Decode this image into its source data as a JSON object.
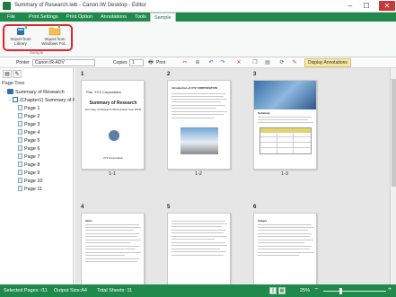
{
  "window": {
    "title": "Summary of Research.iwb - Canon iW Desktop - Editor",
    "minimize": "–",
    "maximize": "☐",
    "close": "✕"
  },
  "ribbon_tabs": [
    "File",
    "Print Settings",
    "Print Option",
    "Annotations",
    "Tools",
    "Sample"
  ],
  "ribbon": {
    "import_library": "Import from Library",
    "import_windows": "Import from Windows Fol...",
    "group_label": "Sample"
  },
  "toolbar": {
    "printer_label": "Printer",
    "printer_value": "Canon iR-ADV",
    "copies_label": "Copies",
    "copies_value": "1",
    "print_label": "Print",
    "display_annotations": "Display Annotations"
  },
  "left_pane": {
    "header": "Page Tree",
    "root": "Summary of Research",
    "chapter": "(Chapter1) Summary of R",
    "pages": [
      "Page 1",
      "Page 2",
      "Page 3",
      "Page 4",
      "Page 5",
      "Page 6",
      "Page 7",
      "Page 8",
      "Page 9",
      "Page 10",
      "Page 11"
    ]
  },
  "thumbnails": {
    "row1": [
      {
        "num": "1",
        "label": "1-1",
        "company": "Pas. XYZ Corporation",
        "heading": "Summary of Research",
        "sub": "Summary of Research Work (Fiscal Year 2015)",
        "footer": "XYZ Corporation"
      },
      {
        "num": "2",
        "label": "1-2",
        "heading": "Introduction of XYZ CORPORATION"
      },
      {
        "num": "3",
        "label": "1-3",
        "heading": "Summary"
      }
    ],
    "row2": [
      {
        "num": "4",
        "heading": "Items"
      },
      {
        "num": "5"
      },
      {
        "num": "6",
        "heading": "Images"
      }
    ]
  },
  "status": {
    "selected": "Selected Pages :/11",
    "output": "Output Size:A4",
    "total": "Total Sheets: 11",
    "zoom": "25%",
    "zoom_minus": "−",
    "zoom_plus": "+"
  },
  "colors": {
    "ribbon_green": "#1f8a4c",
    "highlight_red": "#e0262b",
    "display_annotations_bg": "#f7e7a6"
  }
}
